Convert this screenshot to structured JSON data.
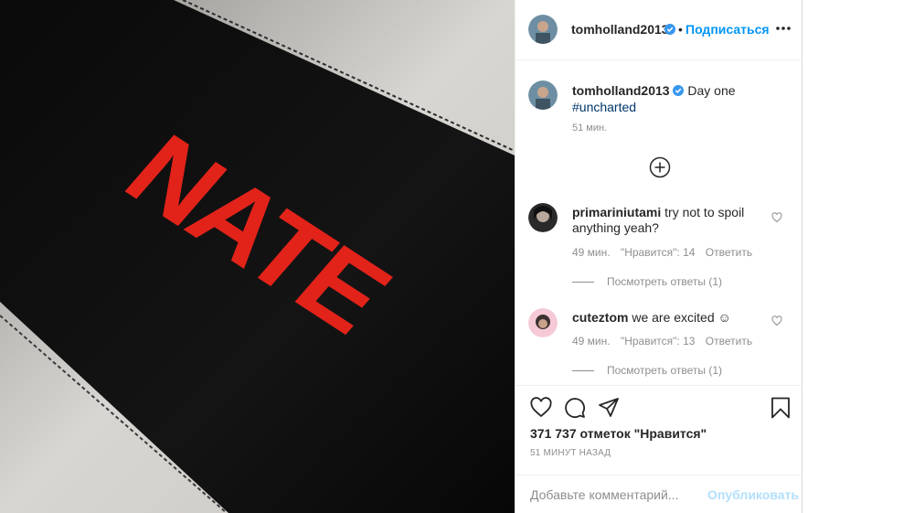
{
  "post": {
    "username": "tomholland2013",
    "follow_label": "Подписаться",
    "separator": "•",
    "caption_text": "Day one",
    "caption_tag": "#uncharted",
    "caption_time": "51 мин.",
    "photo_text": "NATE"
  },
  "comments": [
    {
      "username": "primariniutami",
      "text": "try not to spoil anything yeah?",
      "time": "49 мин.",
      "likes": "\"Нравится\": 14",
      "reply": "Ответить",
      "view_replies": "Посмотреть ответы (1)"
    },
    {
      "username": "cuteztom",
      "text": "we are excited ☺",
      "time": "49 мин.",
      "likes": "\"Нравится\": 13",
      "reply": "Ответить",
      "view_replies": "Посмотреть ответы (1)"
    }
  ],
  "actions": {
    "likes_count": "371 737 отметок \"Нравится\"",
    "timestamp": "51 МИНУТ НАЗАД",
    "comment_placeholder": "Добавьте комментарий...",
    "publish_label": "Опубликовать"
  },
  "colors": {
    "accent": "#0095f6",
    "verified": "#3897f0",
    "photo_text": "#e2231a"
  }
}
